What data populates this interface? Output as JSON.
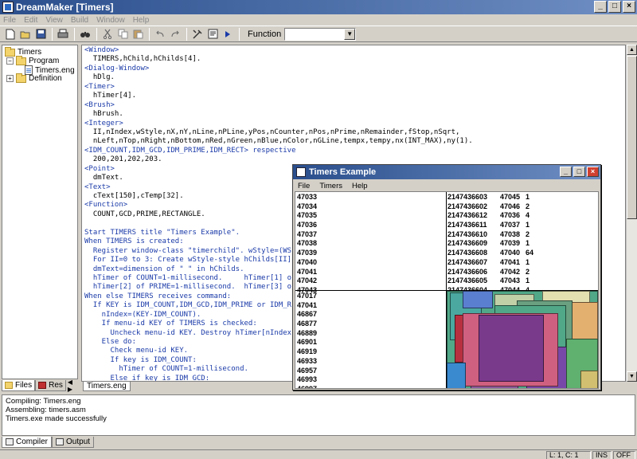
{
  "app": {
    "title": "DreamMaker [Timers]",
    "controls": {
      "minimize": "_",
      "maximize": "□",
      "close": "×"
    }
  },
  "menubar": [
    "File",
    "Edit",
    "View",
    "Build",
    "Window",
    "Help"
  ],
  "toolbar": {
    "function_label": "Function",
    "function_value": ""
  },
  "file_tree": {
    "root": "Timers",
    "program": "Program",
    "file": "Timers.eng",
    "definition": "Definition"
  },
  "left_tabs": [
    "Files",
    "Res"
  ],
  "editor": {
    "tab": "Timers.eng",
    "lines": [
      "<Window>",
      "  TIMERS,hChild,hChilds[4].",
      "<Dialog-Window>",
      "  hDlg.",
      "<Timer>",
      "  hTimer[4].",
      "<Brush>",
      "  hBrush.",
      "<Integer>",
      "  II,nIndex,wStyle,nX,nY,nLine,nPLine,yPos,nCounter,nPos,nPrime,nRemainder,fStop,nSqrt,",
      "  nLeft,nTop,nRight,nBottom,nRed,nGreen,nBlue,nColor,nGLine,tempx,tempy,nx(INT_MAX),ny(1).",
      "<IDM_COUNT,IDM_GCD,IDM_PRIME,IDM_RECT> respective",
      "  200,201,202,203.",
      "<Point>",
      "  dmText.",
      "<Text>",
      "  cText[150],cTemp[32].",
      "<Function>",
      "  COUNT,GCD,PRIME,RECTANGLE.",
      "",
      "Start TIMERS title \"Timers Example\".",
      "When TIMERS is created:",
      "  Register window-class \"timerchild\". wStyle=(WS",
      "  For II=0 to 3: Create wStyle-style hChilds[II]",
      "  dmText=dimension of \" \" in hChilds.",
      "  hTimer of COUNT=1-millisecond.     hTimer[1] o",
      "  hTimer[2] of PRIME=1-millisecond.  hTimer[3] o",
      "When else TIMERS receives command:",
      "  If KEY is IDM_COUNT,IDM_GCD,IDM_PRIME or IDM_R",
      "    nIndex=(KEY-IDM_COUNT).",
      "    If menu-id KEY of TIMERS is checked:",
      "      Uncheck menu-id KEY. Destroy hTimer[nIndex",
      "    Else do:",
      "      Check menu-id KEY.",
      "      If key is IDM_COUNT:",
      "        hTimer of COUNT=1-millisecond.",
      "      Else if key is IDM_GCD:",
      "        hTimer[1] of GCD=1-millisecond."
    ]
  },
  "output": {
    "lines": [
      "Compiling: Timers.eng",
      "Assembling: timers.asm",
      "Timers.exe made successfully"
    ],
    "tabs": [
      "Compiler",
      "Output"
    ]
  },
  "status": {
    "position": "L: 1, C: 1",
    "ins": "INS",
    "ovr": "OFF"
  },
  "child": {
    "title": "Timers Example",
    "menu": [
      "File",
      "Timers",
      "Help"
    ],
    "count_values": [
      "47033",
      "47034",
      "47035",
      "47036",
      "47037",
      "47038",
      "47039",
      "47040",
      "47041",
      "47042",
      "47043"
    ],
    "gcd_rows": [
      [
        "2147436603",
        "47045",
        "1"
      ],
      [
        "2147436602",
        "47046",
        "2"
      ],
      [
        "2147436612",
        "47036",
        "4"
      ],
      [
        "2147436611",
        "47037",
        "1"
      ],
      [
        "2147436610",
        "47038",
        "2"
      ],
      [
        "2147436609",
        "47039",
        "1"
      ],
      [
        "2147436608",
        "47040",
        "64"
      ],
      [
        "2147436607",
        "47041",
        "1"
      ],
      [
        "2147436606",
        "47042",
        "2"
      ],
      [
        "2147436605",
        "47043",
        "1"
      ],
      [
        "2147436604",
        "47044",
        "4"
      ]
    ],
    "prime_values": [
      "47017",
      "47041",
      "46867",
      "46877",
      "46889",
      "46901",
      "46919",
      "46933",
      "46957",
      "46993",
      "46997"
    ],
    "rect_colors": [
      "#5a7fd0",
      "#d2c070",
      "#e4b070",
      "#c2d0a8",
      "#6aa080",
      "#b83040",
      "#7a3a8c",
      "#3a8ad0",
      "#e6e6a0",
      "#8a5a9c",
      "#50a888",
      "#d06080",
      "#e4e0b0",
      "#60b070",
      "#4aa8a0",
      "#7848a8"
    ]
  }
}
